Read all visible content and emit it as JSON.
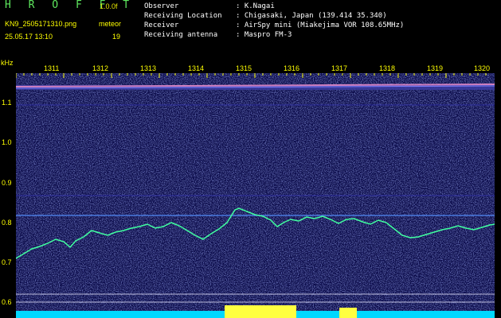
{
  "header": {
    "title": "H R O F F T",
    "version": "1.0.0f",
    "file": "KN9_2505171310.png",
    "timestamp": "25.05.17 13:10",
    "station_label": "meteor",
    "station_number": "19"
  },
  "info": {
    "rows": [
      {
        "label": "Observer",
        "value": ": K.Nagai"
      },
      {
        "label": "Receiving Location",
        "value": ": Chigasaki, Japan (139.414 35.340)"
      },
      {
        "label": "Receiver",
        "value": ": AirSpy mini (Miakejima VOR 108.65MHz)"
      },
      {
        "label": "Receiving antenna",
        "value": ": Maspro FM-3"
      }
    ]
  },
  "axes": {
    "y_unit": "kHz",
    "y_ticks": [
      "1.1",
      "1.0",
      "0.9",
      "0.8",
      "0.7",
      "0.6"
    ],
    "x_ticks": [
      "1311",
      "1312",
      "1313",
      "1314",
      "1315",
      "1316",
      "1317",
      "1318",
      "1319",
      "1320"
    ]
  },
  "colors": {
    "background": "#0a0a4e",
    "label": "#ffff00",
    "title": "#5ee85e",
    "trace": "#40ffa0",
    "band": "#d080c0",
    "bottom": "#00d8ff"
  }
}
